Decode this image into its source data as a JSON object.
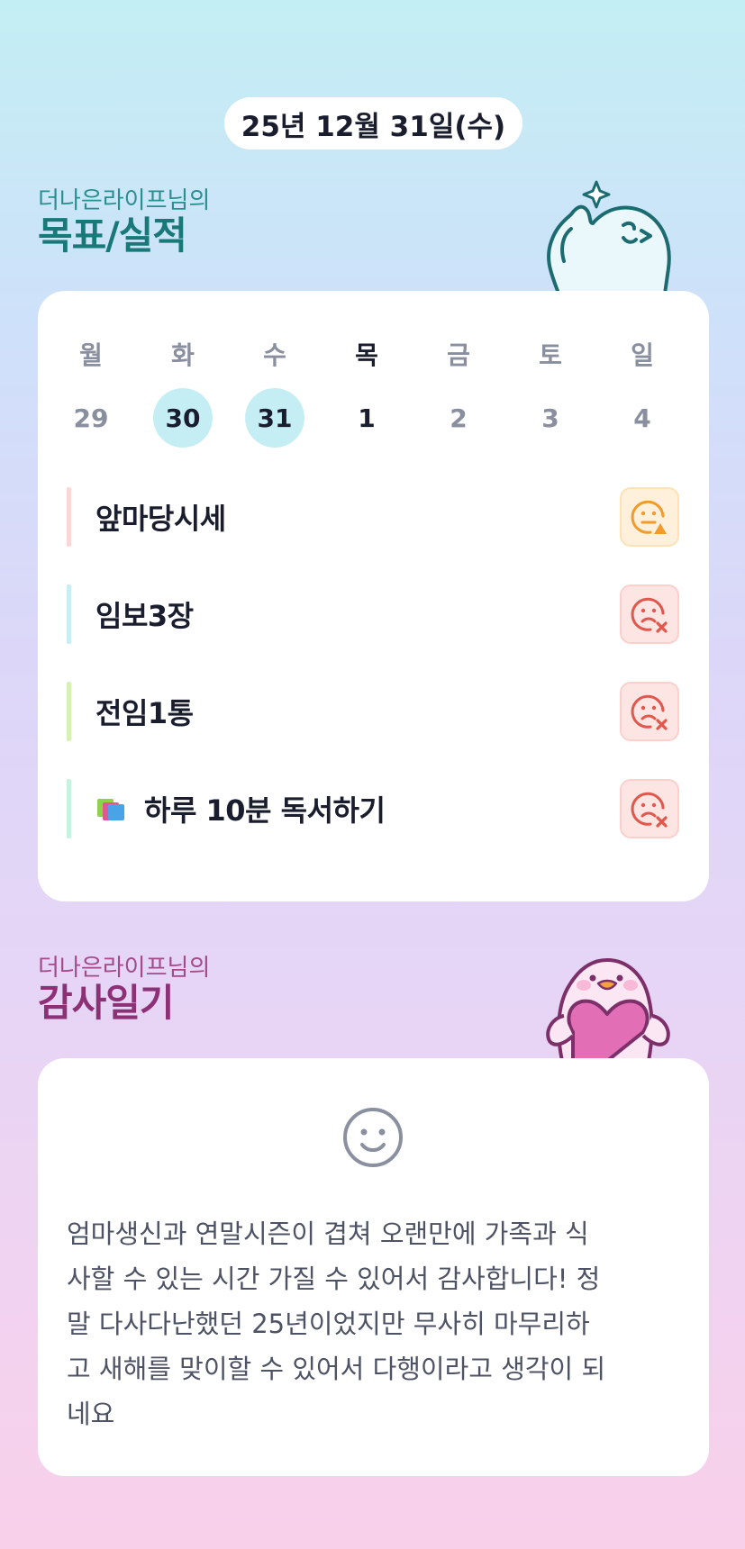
{
  "header": {
    "date": "25년 12월 31일(수)"
  },
  "goals_section": {
    "subtitle": "더나은라이프님의",
    "title": "목표/실적"
  },
  "week": {
    "labels": [
      "월",
      "화",
      "수",
      "목",
      "금",
      "토",
      "일"
    ],
    "dates": [
      "29",
      "30",
      "31",
      "1",
      "2",
      "3",
      "4"
    ]
  },
  "goals": [
    {
      "text": "앞마당시세",
      "bar_color": "#fdd6d6",
      "status": "partial",
      "status_icon": "sad-warning-icon"
    },
    {
      "text": "임보3장",
      "bar_color": "#c7eef6",
      "status": "failed",
      "status_icon": "sad-x-icon"
    },
    {
      "text": "전임1통",
      "bar_color": "#d6f2b0",
      "status": "failed",
      "status_icon": "sad-x-icon"
    },
    {
      "text": "하루 10분 독서하기",
      "bar_color": "#c6f2e2",
      "status": "failed",
      "status_icon": "sad-x-icon",
      "emoji": "books-icon"
    }
  ],
  "diary_section": {
    "subtitle": "더나은라이프님의",
    "title": "감사일기",
    "mood_icon": "smile-icon",
    "lines": [
      "엄마생신과 연말시즌이 겹쳐 오랜만에 가족과 식",
      "사할 수 있는 시간 가질 수 있어서 감사합니다! 정",
      "말 다사다난했던 25년이었지만 무사히 마무리하",
      "고 새해를 맞이할 수 있어서 다행이라고 생각이 되",
      "네요"
    ]
  },
  "colors": {
    "accent_teal": "#197878",
    "accent_plum": "#8c3175",
    "done_day": "#c4eef3",
    "warn": "#f39a2b",
    "fail": "#e2574c"
  }
}
